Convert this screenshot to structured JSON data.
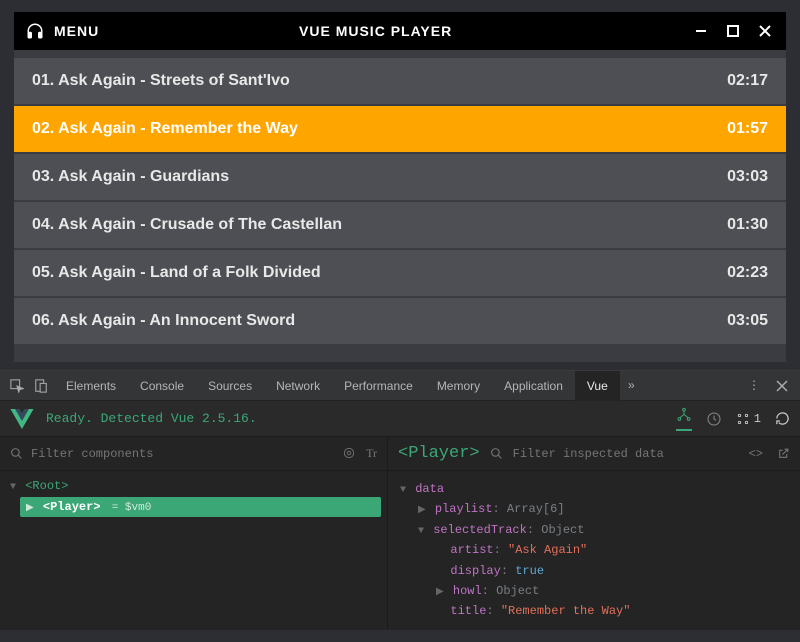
{
  "player": {
    "menu_label": "MENU",
    "title": "VUE MUSIC PLAYER",
    "tracks": [
      {
        "num": "01",
        "artist": "Ask Again",
        "title": "Streets of Sant'Ivo",
        "duration": "02:17",
        "selected": false
      },
      {
        "num": "02",
        "artist": "Ask Again",
        "title": "Remember the Way",
        "duration": "01:57",
        "selected": true
      },
      {
        "num": "03",
        "artist": "Ask Again",
        "title": "Guardians",
        "duration": "03:03",
        "selected": false
      },
      {
        "num": "04",
        "artist": "Ask Again",
        "title": "Crusade of The Castellan",
        "duration": "01:30",
        "selected": false
      },
      {
        "num": "05",
        "artist": "Ask Again",
        "title": "Land of a Folk Divided",
        "duration": "02:23",
        "selected": false
      },
      {
        "num": "06",
        "artist": "Ask Again",
        "title": "An Innocent Sword",
        "duration": "03:05",
        "selected": false
      }
    ]
  },
  "devtools": {
    "tabs": [
      "Elements",
      "Console",
      "Sources",
      "Network",
      "Performance",
      "Memory",
      "Application",
      "Vue"
    ],
    "active_tab": "Vue",
    "vue_status": "Ready. Detected Vue 2.5.16.",
    "instance_count": "1",
    "filter_components_placeholder": "Filter components",
    "filter_inspected_placeholder": "Filter inspected data",
    "tree": {
      "root_label": "<Root>",
      "player_label": "<Player>",
      "vm_label": "= $vm0"
    },
    "inspector": {
      "title": "<Player>",
      "section": "data",
      "lines": {
        "playlist_key": "playlist",
        "playlist_val": "Array[6]",
        "sel_key": "selectedTrack",
        "sel_val": "Object",
        "artist_key": "artist",
        "artist_val": "\"Ask Again\"",
        "display_key": "display",
        "display_val": "true",
        "howl_key": "howl",
        "howl_val": "Object",
        "title_key": "title",
        "title_val": "\"Remember the Way\""
      }
    }
  }
}
